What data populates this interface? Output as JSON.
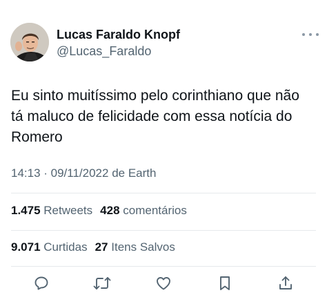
{
  "author": {
    "display_name": "Lucas Faraldo Knopf",
    "handle": "@Lucas_Faraldo"
  },
  "tweet": {
    "text_lines": [
      "Eu sinto muitíssimo pelo corinthiano que não",
      "tá maluco de felicidade com essa notícia do",
      "Romero"
    ],
    "meta": "14:13 · 09/11/2022 de Earth"
  },
  "stats_row_1": {
    "retweets_count": "1.475",
    "retweets_label": "Retweets",
    "comments_count": "428",
    "comments_label": "comentários"
  },
  "stats_row_2": {
    "likes_count": "9.071",
    "likes_label": "Curtidas",
    "saved_count": "27",
    "saved_label": "Itens Salvos"
  },
  "icons": {
    "more": "more-dots-icon",
    "reply": "reply-icon",
    "retweet": "retweet-icon",
    "like": "heart-icon",
    "bookmark": "bookmark-icon",
    "share": "share-icon"
  },
  "colors": {
    "text_primary": "#0f1419",
    "text_secondary": "#536471",
    "divider": "#e6e9ec",
    "icon": "#536471"
  }
}
